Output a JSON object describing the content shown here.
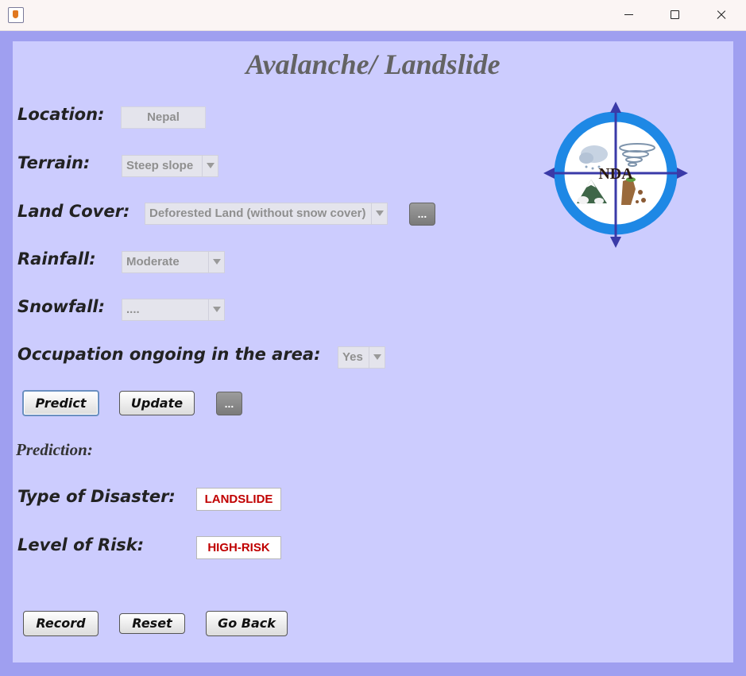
{
  "window": {
    "title": ""
  },
  "form": {
    "title": "Avalanche/ Landslide",
    "location": {
      "label": "Location:",
      "value": "Nepal"
    },
    "terrain": {
      "label": "Terrain:",
      "value": "Steep slope"
    },
    "land_cover": {
      "label": "Land Cover:",
      "value": "Deforested Land (without snow cover)",
      "more": "..."
    },
    "rainfall": {
      "label": "Rainfall:",
      "value": "Moderate"
    },
    "snowfall": {
      "label": "Snowfall:",
      "value": "...."
    },
    "occupation": {
      "label": "Occupation ongoing in the area:",
      "value": "Yes"
    },
    "buttons": {
      "predict": "Predict",
      "update": "Update",
      "more": "...",
      "record": "Record",
      "reset": "Reset",
      "go_back": "Go Back"
    },
    "prediction": {
      "label": "Prediction:",
      "type_label": "Type of Disaster:",
      "type_value": "LANDSLIDE",
      "risk_label": "Level of Risk:",
      "risk_value": "HIGH-RISK"
    },
    "logo": {
      "text": "NDA"
    }
  },
  "colors": {
    "panel": "#ccccfe",
    "frame": "#9f9ff0",
    "result_text": "#c00000",
    "logo_ring": "#1e88e5",
    "logo_arrows": "#3a3aa8"
  }
}
